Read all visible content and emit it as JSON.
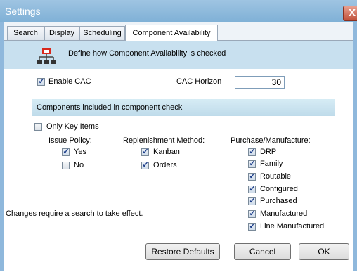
{
  "window": {
    "title": "Settings",
    "close_glyph": "X"
  },
  "tabs": [
    {
      "label": "Search"
    },
    {
      "label": "Display"
    },
    {
      "label": "Scheduling"
    },
    {
      "label": "Component Availability",
      "active": true
    }
  ],
  "banner": {
    "icon": "network-hierarchy-icon",
    "text": "Define how Component Availability is checked"
  },
  "enable_cac": {
    "label": "Enable CAC",
    "checked": true
  },
  "cac_horizon": {
    "label": "CAC Horizon",
    "value": "30"
  },
  "section": {
    "heading": "Components included in component check"
  },
  "only_key_items": {
    "label": "Only Key Items",
    "checked": false
  },
  "issue_policy": {
    "heading": "Issue Policy:",
    "options": [
      {
        "label": "Yes",
        "checked": true
      },
      {
        "label": "No",
        "checked": false
      }
    ]
  },
  "replenishment": {
    "heading": "Replenishment Method:",
    "options": [
      {
        "label": "Kanban",
        "checked": true
      },
      {
        "label": "Orders",
        "checked": true
      }
    ]
  },
  "purchase_manufacture": {
    "heading": "Purchase/Manufacture:",
    "options": [
      {
        "label": "DRP",
        "checked": true
      },
      {
        "label": "Family",
        "checked": true
      },
      {
        "label": "Routable",
        "checked": true
      },
      {
        "label": "Configured",
        "checked": true
      },
      {
        "label": "Purchased",
        "checked": true
      },
      {
        "label": "Manufactured",
        "checked": true
      },
      {
        "label": "Line Manufactured",
        "checked": true
      }
    ]
  },
  "note": "Changes require a search to take effect.",
  "buttons": {
    "restore": "Restore Defaults",
    "cancel": "Cancel",
    "ok": "OK"
  },
  "colors": {
    "title_bar": "#8fb8dc",
    "banner": "#c8e0ef",
    "check": "#1e3f8a"
  }
}
